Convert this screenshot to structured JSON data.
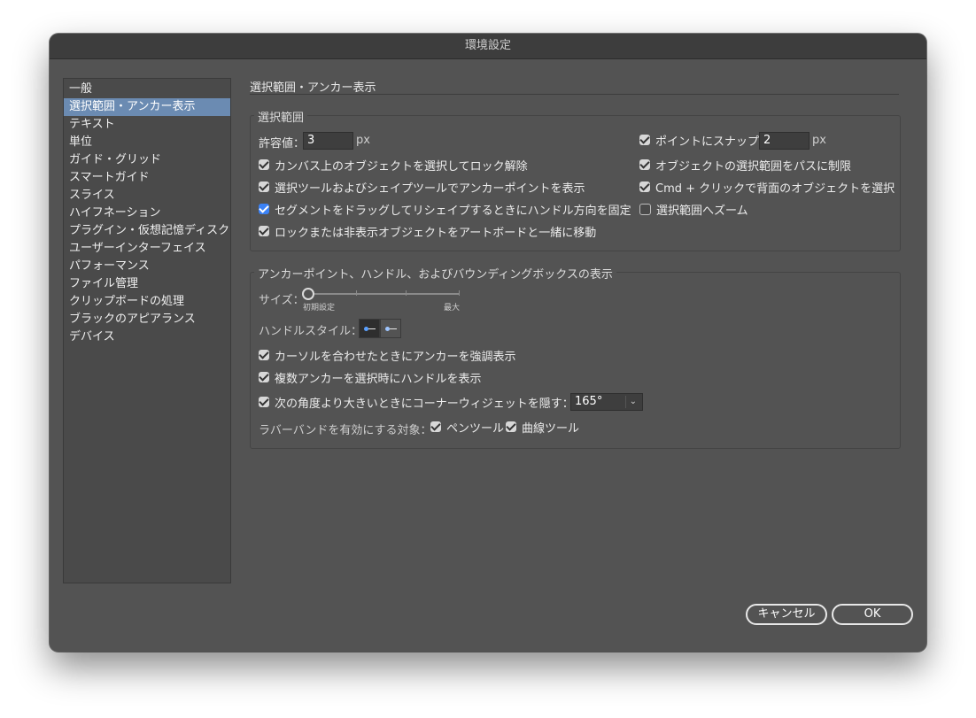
{
  "window": {
    "title": "環境設定"
  },
  "sidebar": {
    "items": [
      {
        "label": "一般"
      },
      {
        "label": "選択範囲・アンカー表示",
        "selected": true
      },
      {
        "label": "テキスト"
      },
      {
        "label": "単位"
      },
      {
        "label": "ガイド・グリッド"
      },
      {
        "label": "スマートガイド"
      },
      {
        "label": "スライス"
      },
      {
        "label": "ハイフネーション"
      },
      {
        "label": "プラグイン・仮想記憶ディスク"
      },
      {
        "label": "ユーザーインターフェイス"
      },
      {
        "label": "パフォーマンス"
      },
      {
        "label": "ファイル管理"
      },
      {
        "label": "クリップボードの処理"
      },
      {
        "label": "ブラックのアピアランス"
      },
      {
        "label": "デバイス"
      }
    ]
  },
  "page": {
    "title": "選択範囲・アンカー表示"
  },
  "selection": {
    "group_label": "選択範囲",
    "tolerance_label": "許容値：",
    "tolerance_value": "3",
    "tolerance_unit": "px",
    "snap_label": "ポイントにスナップ",
    "snap_checked": true,
    "snap_value": "2",
    "snap_unit": "px",
    "left_checks": [
      {
        "label": "カンバス上のオブジェクトを選択してロック解除",
        "checked": true
      },
      {
        "label": "選択ツールおよびシェイプツールでアンカーポイントを表示",
        "checked": true
      },
      {
        "label": "セグメントをドラッグしてリシェイプするときにハンドル方向を固定",
        "checked": true
      },
      {
        "label": "ロックまたは非表示オブジェクトをアートボードと一緒に移動",
        "checked": true
      }
    ],
    "right_checks": [
      {
        "label": "オブジェクトの選択範囲をパスに制限",
        "checked": true
      },
      {
        "label": "Cmd + クリックで背面のオブジェクトを選択",
        "checked": true
      },
      {
        "label": "選択範囲へズーム",
        "checked": false
      }
    ]
  },
  "anchor": {
    "group_label": "アンカーポイント、ハンドル、およびバウンディングボックスの表示",
    "size_label": "サイズ：",
    "size_min_label": "初期設定",
    "size_max_label": "最大",
    "size_level": 0,
    "handle_style_label": "ハンドルスタイル：",
    "checks": [
      {
        "label": "カーソルを合わせたときにアンカーを強調表示",
        "checked": true
      },
      {
        "label": "複数アンカーを選択時にハンドルを表示",
        "checked": true
      },
      {
        "label": "次の角度より大きいときにコーナーウィジェットを隠す：",
        "checked": true
      }
    ],
    "angle_value": "165°",
    "rubber_band_label": "ラバーバンドを有効にする対象：",
    "pen_tool_label": "ペンツール",
    "pen_tool_checked": true,
    "curvature_tool_label": "曲線ツール",
    "curvature_tool_checked": true
  },
  "buttons": {
    "cancel": "キャンセル",
    "ok": "OK"
  }
}
